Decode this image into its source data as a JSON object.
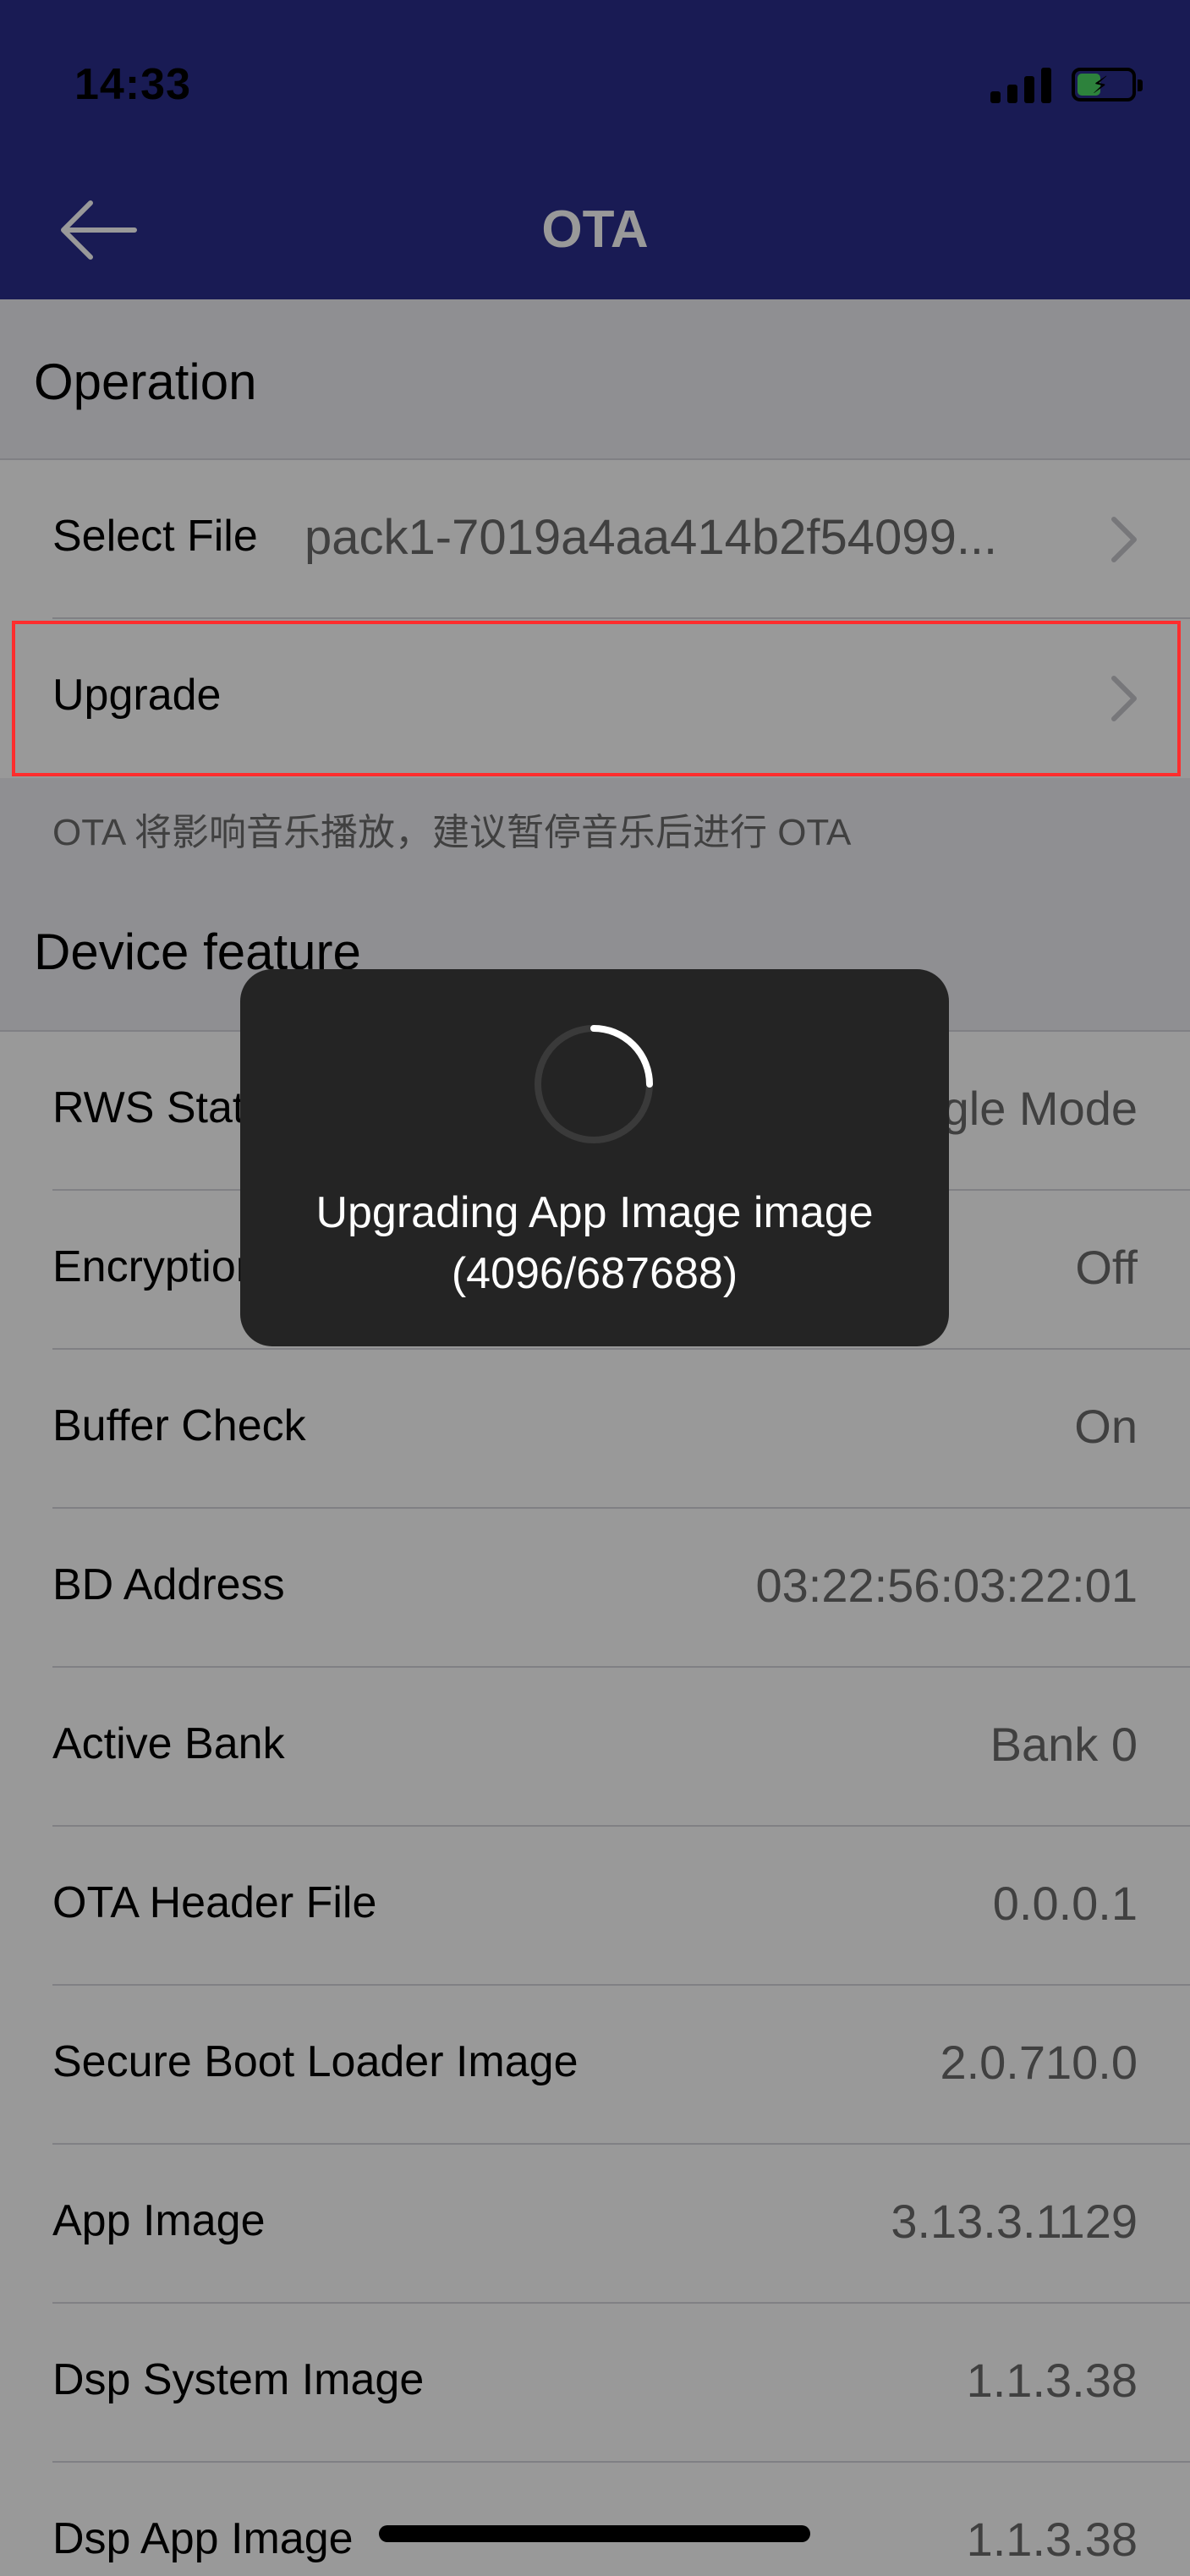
{
  "status_bar": {
    "time": "14:33"
  },
  "nav": {
    "title": "OTA"
  },
  "operation": {
    "header": "Operation",
    "select_file": {
      "label": "Select File",
      "value": "pack1-7019a4aa414b2f54099..."
    },
    "upgrade": {
      "label": "Upgrade"
    },
    "note": "OTA 将影响音乐播放，建议暂停音乐后进行 OTA"
  },
  "device_feature": {
    "header": "Device feature",
    "rows": [
      {
        "label": "RWS Status",
        "value": "Single Mode"
      },
      {
        "label": "Encryption",
        "value": "Off"
      },
      {
        "label": "Buffer Check",
        "value": "On"
      },
      {
        "label": "BD Address",
        "value": "03:22:56:03:22:01"
      },
      {
        "label": "Active Bank",
        "value": "Bank 0"
      },
      {
        "label": "OTA Header File",
        "value": "0.0.0.1"
      },
      {
        "label": "Secure Boot Loader Image",
        "value": "2.0.710.0"
      },
      {
        "label": "App Image",
        "value": "3.13.3.1129"
      },
      {
        "label": "Dsp System Image",
        "value": "1.1.3.38"
      },
      {
        "label": "Dsp App Image",
        "value": "1.1.3.38"
      }
    ]
  },
  "toast": {
    "line1": "Upgrading App Image image",
    "line2": "(4096/687688)"
  },
  "colors": {
    "nav_bar": "#2a2d8c",
    "highlight": "#ff2d2d",
    "toast_bg": "#242424"
  }
}
